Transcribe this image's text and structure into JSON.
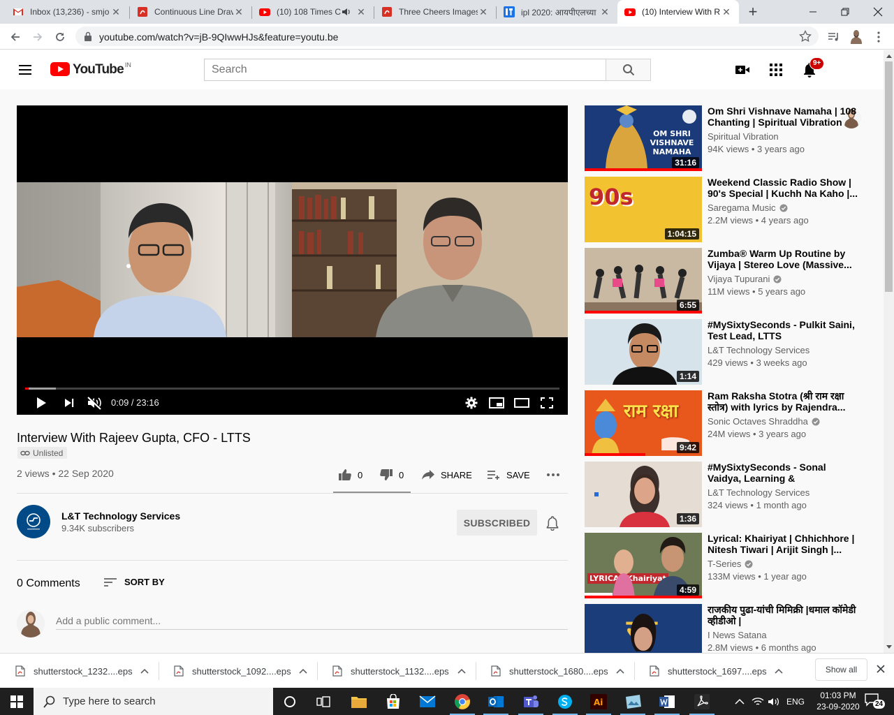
{
  "browser": {
    "tabs": [
      {
        "title": "Inbox (13,236) - smjo",
        "icon": "gmail-icon"
      },
      {
        "title": "Continuous Line Drav",
        "icon": "pdf-icon"
      },
      {
        "title": "(10) 108 Times C",
        "icon": "youtube-icon",
        "audio": true
      },
      {
        "title": "Three Cheers Images",
        "icon": "pdf-icon"
      },
      {
        "title": "ipl 2020: आयपीएलच्या",
        "icon": "news-icon"
      },
      {
        "title": "(10) Interview With R",
        "icon": "youtube-icon",
        "active": true
      }
    ],
    "url": "youtube.com/watch?v=jB-9QIwwHJs&feature=youtu.be"
  },
  "masthead": {
    "logo_text": "YouTube",
    "country": "IN",
    "search_placeholder": "Search",
    "notification_count": "9+"
  },
  "player": {
    "timecode": "0:09 / 23:16",
    "progress_fraction": 0.0065
  },
  "video": {
    "title": "Interview With Rajeev Gupta, CFO - LTTS",
    "privacy": "Unlisted",
    "view_info": "2 views • 22 Sep 2020",
    "likes": "0",
    "dislikes": "0",
    "share_label": "SHARE",
    "save_label": "SAVE",
    "like_ratio": 0
  },
  "channel": {
    "name": "L&T Technology Services",
    "subscribers": "9.34K subscribers",
    "subscribe_label": "SUBSCRIBED"
  },
  "comments": {
    "count_label": "0 Comments",
    "sort_label": "SORT BY",
    "placeholder": "Add a public comment..."
  },
  "recommendations": [
    {
      "title": "Om Shri Vishnave Namaha | 108 Chanting | Spiritual Vibration",
      "channel": "Spiritual Vibration",
      "verified": false,
      "meta": "94K views • 3 years ago",
      "duration": "31:16",
      "thumb_color": "#1a3a7a",
      "thumb_text": "OM SHRI VISHNAVE NAMAHA",
      "watched": 1.0
    },
    {
      "title": "Weekend Classic Radio Show | 90's Special | Kuchh Na Kaho |...",
      "channel": "Saregama Music",
      "verified": true,
      "meta": "2.2M views • 4 years ago",
      "duration": "1:04:15",
      "thumb_color": "#f2c230",
      "thumb_text": "90s",
      "watched": 0
    },
    {
      "title": "Zumba® Warm Up Routine by Vijaya | Stereo Love (Massive...",
      "channel": "Vijaya Tupurani",
      "verified": true,
      "meta": "11M views • 5 years ago",
      "duration": "6:55",
      "thumb_color": "#c9b9a3",
      "thumb_text": "",
      "watched": 1.0
    },
    {
      "title": "#MySixtySeconds - Pulkit Saini, Test Lead, LTTS",
      "channel": "L&T Technology Services",
      "verified": false,
      "meta": "429 views • 3 weeks ago",
      "duration": "1:14",
      "thumb_color": "#d7e3ea",
      "thumb_text": "",
      "watched": 0
    },
    {
      "title": "Ram Raksha Stotra (श्री राम रक्षा स्तोत्र) with lyrics by Rajendra...",
      "channel": "Sonic Octaves Shraddha",
      "verified": true,
      "meta": "24M views • 3 years ago",
      "duration": "9:42",
      "thumb_color": "#e8581c",
      "thumb_text": "राम रक्षा",
      "watched": 0.52
    },
    {
      "title": "#MySixtySeconds - Sonal Vaidya, Learning & Development",
      "channel": "L&T Technology Services",
      "verified": false,
      "meta": "324 views • 1 month ago",
      "duration": "1:36",
      "thumb_color": "#e5ddd3",
      "thumb_text": "",
      "watched": 0
    },
    {
      "title": "Lyrical: Khairiyat | Chhichhore | Nitesh Tiwari | Arijit Singh |...",
      "channel": "T-Series",
      "verified": true,
      "meta": "133M views • 1 year ago",
      "duration": "4:59",
      "thumb_color": "#6d7a55",
      "thumb_text": "LYRICAL Khairiyat",
      "watched": 1.0
    },
    {
      "title": "राजकीय पुढा-यांची मिमिक्री |धमाल कॉमेडी व्हीडीओ |",
      "channel": "I News Satana",
      "verified": false,
      "meta": "2.8M views • 6 months ago",
      "duration": "",
      "thumb_color": "#1b3e7a",
      "thumb_text": "रस",
      "watched": 0
    }
  ],
  "downloads": {
    "files": [
      "shutterstock_1232....eps",
      "shutterstock_1092....eps",
      "shutterstock_1132....eps",
      "shutterstock_1680....eps",
      "shutterstock_1697....eps"
    ],
    "show_all_label": "Show all"
  },
  "taskbar": {
    "search_placeholder": "Type here to search",
    "language": "ENG",
    "time": "01:03 PM",
    "date": "23-09-2020",
    "notification_count": "24"
  }
}
